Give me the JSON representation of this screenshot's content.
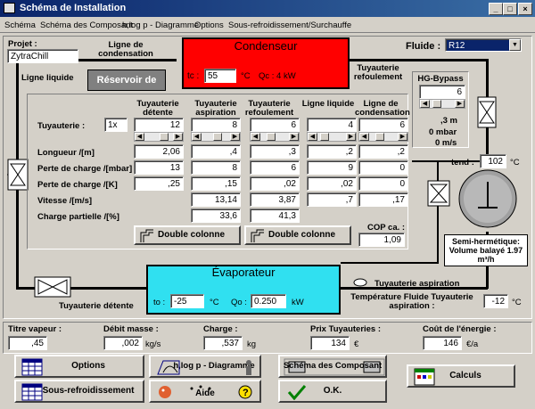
{
  "window": {
    "title": "Schéma de Installation"
  },
  "menu": [
    "Schéma",
    "Schéma des Composant",
    "h,log p - Diagramme",
    "Options",
    "Sous-refroidissement/Surchauffe"
  ],
  "projet": {
    "label": "Projet :",
    "value": "ZytraChill"
  },
  "fluide": {
    "label": "Fluide :",
    "value": "R12"
  },
  "labels": {
    "ligne_condensation": "Ligne de condensation",
    "ligne_liquide": "Ligne liquide",
    "reservoir": "Réservoir de",
    "tuyauterie_refoulement": "Tuyauterie refoulement",
    "tuyauterie_aspiration": "Tuyauterie aspiration",
    "tuyauterie_detente": "Tuyauterie détente"
  },
  "condenseur": {
    "title": "Condenseur",
    "tc_label": "tc :",
    "tc_value": "55",
    "tc_unit": "°C",
    "qc_text": "Qc : 4 kW"
  },
  "hg_bypass": {
    "title": "HG-Bypass",
    "value": "6",
    "m": ",3 m",
    "mbar": "0 mbar",
    "ms": "0 m/s"
  },
  "tend": {
    "label": "tend :",
    "value": "102",
    "unit": "°C"
  },
  "compressor": {
    "type_text": "Semi-hermétique:",
    "volume_text": "Volume balayé  1.97",
    "unit_text": "m³/h"
  },
  "table": {
    "columns": [
      "Tuyauterie détente",
      "Tuyauterie aspiration",
      "Tuyauterie refoulement",
      "Ligne liquide",
      "Ligne de condensation"
    ],
    "tuyauterie_label": "Tuyauterie :",
    "multiplier": "1x",
    "tuyauterie": [
      "12",
      "8",
      "6",
      "4",
      "6"
    ],
    "rows": [
      {
        "label": "Longueur /[m]",
        "values": [
          "2,06",
          ",4",
          ",3",
          ",2",
          ",2"
        ]
      },
      {
        "label": "Perte de charge /[mbar]",
        "values": [
          "13",
          "8",
          "6",
          "9",
          "0"
        ]
      },
      {
        "label": "Perte de charge /[K]",
        "values": [
          ",25",
          ",15",
          ",02",
          ",02",
          "0"
        ]
      },
      {
        "label": "Vitesse /[m/s]",
        "values": [
          "",
          "13,14",
          "3,87",
          ",7",
          ",17"
        ]
      },
      {
        "label": "Charge partielle /[%]",
        "values": [
          "",
          "33,6",
          "41,3",
          "",
          ""
        ]
      }
    ],
    "double_colonne": "Double colonne",
    "cop_label": "COP ca. :",
    "cop_value": "1,09"
  },
  "evaporateur": {
    "title": "Évaporateur",
    "to_label": "to :",
    "to_value": "-25",
    "to_unit": "°C",
    "qo_label": "Qo :",
    "qo_value": "0.250",
    "qo_unit": "kW"
  },
  "temp_fluide": {
    "label": "Température Fluide Tuyauterie aspiration :",
    "value": "-12",
    "unit": "°C"
  },
  "bottom": {
    "titre_vapeur": {
      "label": "Titre vapeur :",
      "value": ",45"
    },
    "debit_masse": {
      "label": "Débit masse :",
      "value": ",002",
      "unit": "kg/s"
    },
    "charge": {
      "label": "Charge :",
      "value": ",537",
      "unit": "kg"
    },
    "prix": {
      "label": "Prix Tuyauteries :",
      "value": "134",
      "unit": "€"
    },
    "cout": {
      "label": "Coût de l'énergie :",
      "value": "146",
      "unit": "€/a"
    }
  },
  "buttons": {
    "options": "Options",
    "hlogp": "h,log p - Diagramme",
    "schema": "Schéma des Composant",
    "calculs": "Calculs",
    "sous_refr": "Sous-refroidissement",
    "aide": "Aide",
    "ok": "O.K."
  }
}
